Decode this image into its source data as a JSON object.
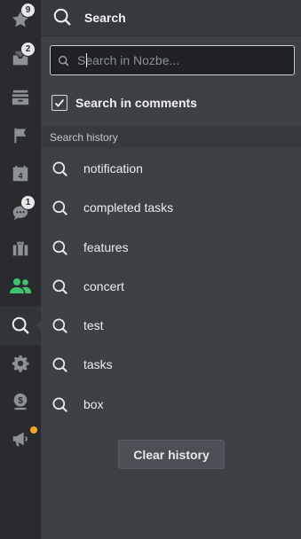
{
  "sidebar": {
    "badges": {
      "starred": "9",
      "inbox": "2",
      "comments": "1"
    },
    "active_item": "search"
  },
  "header": {
    "title": "Search"
  },
  "search": {
    "placeholder": "Search in Nozbe...",
    "value": ""
  },
  "options": {
    "search_in_comments_label": "Search in comments",
    "search_in_comments_checked": true
  },
  "history": {
    "section_label": "Search history",
    "items": [
      "notification",
      "completed tasks",
      "features",
      "concert",
      "test",
      "tasks",
      "box"
    ]
  },
  "actions": {
    "clear_history_label": "Clear history"
  },
  "colors": {
    "accent_green": "#3ec46d",
    "notification_dot": "#f5a623",
    "rail_bg": "#292b2f",
    "panel_bg": "#3d4045"
  }
}
